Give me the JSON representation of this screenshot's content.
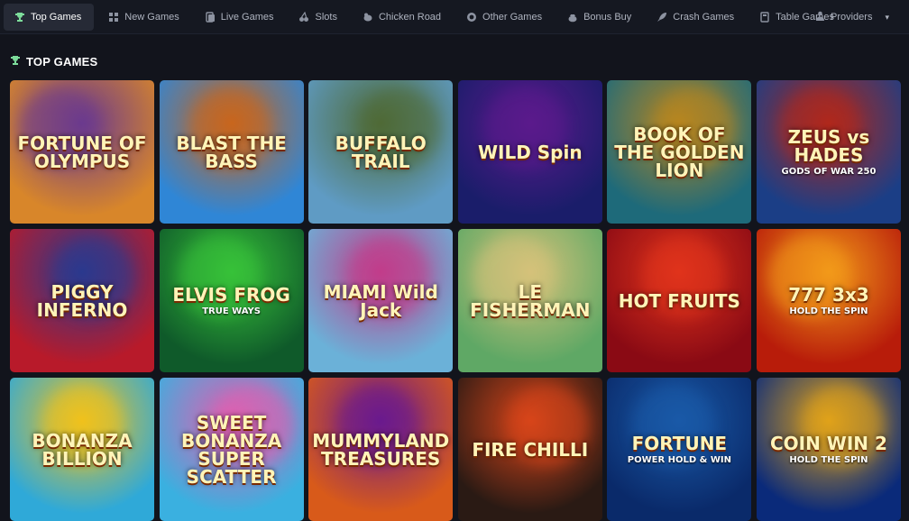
{
  "nav": {
    "tabs": [
      {
        "label": "Top Games",
        "icon": "trophy-icon",
        "active": true
      },
      {
        "label": "New Games",
        "icon": "grid-icon"
      },
      {
        "label": "Live Games",
        "icon": "cards-icon"
      },
      {
        "label": "Slots",
        "icon": "cherry-icon"
      },
      {
        "label": "Chicken Road",
        "icon": "chicken-icon"
      },
      {
        "label": "Other Games",
        "icon": "coin-icon"
      },
      {
        "label": "Bonus Buy",
        "icon": "bag-icon"
      },
      {
        "label": "Crash Games",
        "icon": "rocket-icon"
      },
      {
        "label": "Table Games",
        "icon": "table-icon"
      }
    ],
    "providers_label": "Providers"
  },
  "section": {
    "title": "TOP GAMES",
    "icon": "trophy-icon"
  },
  "games": [
    {
      "title": "FORTUNE OF OLYMPUS",
      "subtitle": "",
      "colors": [
        "#d8862a",
        "#6b3a8e"
      ]
    },
    {
      "title": "BLAST THE BASS",
      "subtitle": "",
      "colors": [
        "#2f86d6",
        "#c9661d"
      ]
    },
    {
      "title": "BUFFALO TRAIL",
      "subtitle": "",
      "colors": [
        "#5f9bc4",
        "#4f6a36"
      ]
    },
    {
      "title": "WILD Spin",
      "subtitle": "",
      "colors": [
        "#1a1d6a",
        "#5b1a8c"
      ]
    },
    {
      "title": "BOOK OF THE GOLDEN LION",
      "subtitle": "",
      "colors": [
        "#1e6a7a",
        "#b8861f"
      ]
    },
    {
      "title": "ZEUS vs HADES",
      "subtitle": "GODS OF WAR 250",
      "colors": [
        "#1b3e86",
        "#b0281c"
      ]
    },
    {
      "title": "PIGGY INFERNO",
      "subtitle": "",
      "colors": [
        "#b81a2a",
        "#2b3a8e"
      ]
    },
    {
      "title": "ELVIS FROG",
      "subtitle": "TRUE WAYS",
      "colors": [
        "#0f5a2a",
        "#38c23a"
      ]
    },
    {
      "title": "MIAMI Wild Jack",
      "subtitle": "",
      "colors": [
        "#6bb1d8",
        "#c23c8a"
      ]
    },
    {
      "title": "LE FISHERMAN",
      "subtitle": "",
      "colors": [
        "#5fa865",
        "#d5c27a"
      ]
    },
    {
      "title": "HOT FRUITS",
      "subtitle": "",
      "colors": [
        "#8a0a14",
        "#e0341c"
      ]
    },
    {
      "title": "777 3x3",
      "subtitle": "HOLD THE SPIN",
      "colors": [
        "#b81c0a",
        "#f29a1a"
      ]
    },
    {
      "title": "BONANZA BILLION",
      "subtitle": "",
      "colors": [
        "#2fa9d8",
        "#f0c21c"
      ]
    },
    {
      "title": "SWEET BONANZA SUPER SCATTER",
      "subtitle": "",
      "colors": [
        "#3ab0e0",
        "#e05fb0"
      ]
    },
    {
      "title": "MUMMYLAND TREASURES",
      "subtitle": "",
      "colors": [
        "#d85a1a",
        "#6a1a8e"
      ]
    },
    {
      "title": "FIRE CHILLI",
      "subtitle": "",
      "colors": [
        "#2a1a14",
        "#d8451a"
      ]
    },
    {
      "title": "FORTUNE",
      "subtitle": "POWER HOLD & WIN",
      "colors": [
        "#0a2a6a",
        "#1a5aa8"
      ]
    },
    {
      "title": "COIN WIN 2",
      "subtitle": "HOLD THE SPIN",
      "colors": [
        "#0a2a7a",
        "#e0a21a"
      ]
    }
  ]
}
